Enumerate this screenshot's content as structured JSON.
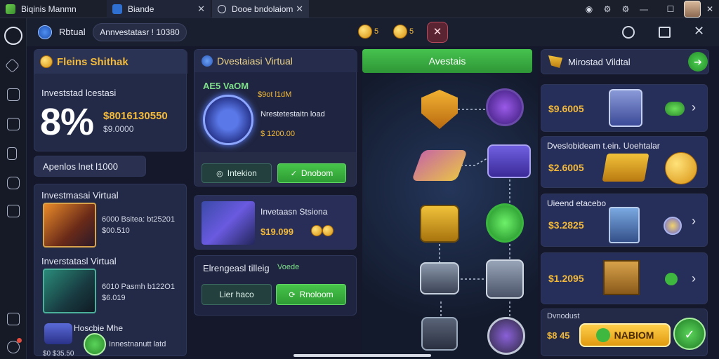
{
  "titlebar": {
    "tabs": [
      {
        "label": "Biqinis Manmn"
      },
      {
        "label": "Biande"
      },
      {
        "label": "Dooe bndolaiom"
      }
    ]
  },
  "subbar": {
    "mode_label": "Rbtual",
    "title": "Annvestatasr ! 10380",
    "coin_a": "5",
    "coin_b": "5"
  },
  "left": {
    "header": "Fleins Shithak",
    "invest_label": "Investstad lcestasi",
    "big_value": "8%",
    "amount_main": "$8016130550",
    "amount_sub": "$9.0000",
    "apendes": "Apenlos lnet l1000",
    "cards": [
      {
        "title": "Investmasai Virtual",
        "line1": "6000 Bsitea: bt25201",
        "line2": "$00.510"
      },
      {
        "title": "Inverstatasl Virtual",
        "line1": "6010 Pasmh b122O1",
        "line2": "$6.019"
      }
    ],
    "bottom_title": "Hoscbie Mhe",
    "bottom_line": "Innestnanutt latd",
    "bottom_value": "$0 $35.50"
  },
  "mid": {
    "header": "Dvestaiasi Virtual",
    "tag": "AE5 VaOM",
    "side_label": "$9ot l1dM",
    "item_title": "Nrestetestaitn load",
    "item_value": "$ 1200.00",
    "btn_a": "Intekion",
    "btn_b": "Dnobom",
    "card_title": "Invetaasn Stsiona",
    "card_value": "$19.099",
    "section_title": "Elrengeasl tilleig",
    "section_tag": "Voede",
    "btn_c": "Lier haco",
    "btn_d": "Rnoloom"
  },
  "tree": {
    "header": "Avestais"
  },
  "right": {
    "header": "Mirostad Vildtal",
    "items": [
      {
        "value": "$9.6005",
        "label": ""
      },
      {
        "value": "$2.6005",
        "label": "Dveslobideam t.ein. Uoehtalar"
      },
      {
        "value": "$3.2825",
        "label": "Uieend etacebo"
      },
      {
        "value": "$1.2095",
        "label": ""
      }
    ],
    "footer_label": "Dvnodust",
    "footer_value": "$8 45",
    "footer_btn": "NABIOM"
  },
  "colors": {
    "accent_green": "#3bb54a",
    "gold": "#f2b93a",
    "panel": "#222842"
  }
}
